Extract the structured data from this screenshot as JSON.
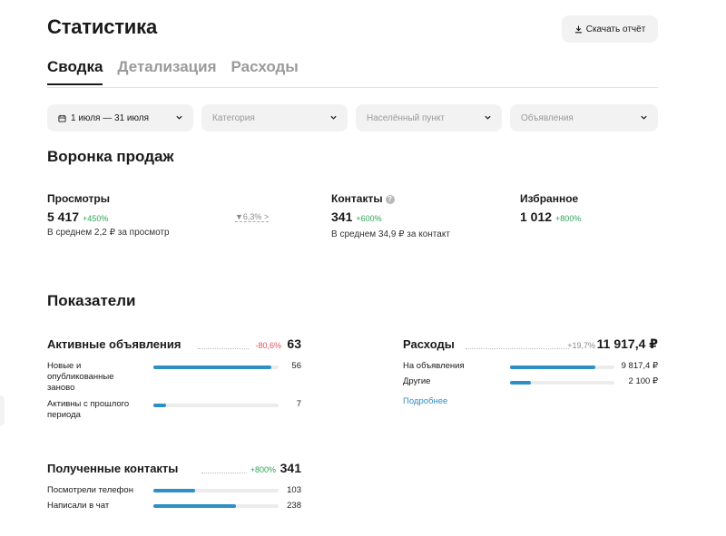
{
  "header": {
    "title": "Статистика",
    "download_label": "Скачать отчёт"
  },
  "tabs": [
    {
      "label": "Сводка",
      "active": true
    },
    {
      "label": "Детализация",
      "active": false
    },
    {
      "label": "Расходы",
      "active": false
    }
  ],
  "filters": {
    "date": "1 июля — 31 июля",
    "category_placeholder": "Категория",
    "city_placeholder": "Населённый пункт",
    "ads_placeholder": "Объявления"
  },
  "funnel": {
    "title": "Воронка продаж",
    "views": {
      "label": "Просмотры",
      "value": "5 417",
      "delta": "+450%",
      "sub": "В среднем 2,2 ₽ за просмотр"
    },
    "conversion": "▼6,3% >",
    "contacts": {
      "label": "Контакты",
      "value": "341",
      "delta": "+600%",
      "sub": "В среднем 34,9 ₽ за контакт"
    },
    "favorites": {
      "label": "Избранное",
      "value": "1 012",
      "delta": "+800%"
    }
  },
  "indicators": {
    "title": "Показатели",
    "active_ads": {
      "label": "Активные объявления",
      "delta": "-80,6%",
      "total": "63",
      "rows": [
        {
          "label": "Новые и опубликованные заново",
          "value": "56",
          "fraction": 0.94
        },
        {
          "label": "Активны с прошлого периода",
          "value": "7",
          "fraction": 0.1
        }
      ]
    },
    "expenses": {
      "label": "Расходы",
      "delta": "+19,7%",
      "total": "11 917,4 ₽",
      "rows": [
        {
          "label": "На объявления",
          "value": "9 817,4 ₽",
          "fraction": 0.82
        },
        {
          "label": "Другие",
          "value": "2 100 ₽",
          "fraction": 0.2
        }
      ],
      "more_label": "Подробнее"
    },
    "contacts": {
      "label": "Полученные контакты",
      "delta": "+800%",
      "total": "341",
      "rows": [
        {
          "label": "Посмотрели телефон",
          "value": "103",
          "fraction": 0.33
        },
        {
          "label": "Написали в чат",
          "value": "238",
          "fraction": 0.66
        }
      ]
    }
  },
  "colors": {
    "accent_bar": "#2d8fc5",
    "positive": "#2fa35a",
    "negative": "#e0505b",
    "link": "#2d8fc5"
  },
  "icons": {
    "download": "download-icon",
    "calendar": "calendar-icon",
    "chevron": "chevron-down-icon",
    "info": "info-icon"
  }
}
